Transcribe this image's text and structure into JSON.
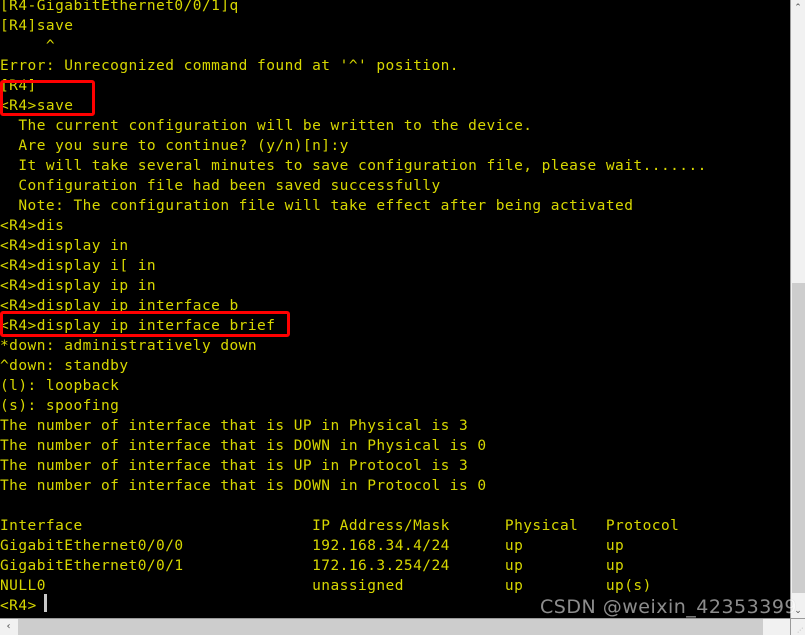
{
  "terminal": {
    "text_color": "#d7d700",
    "background_color": "#000000",
    "highlight_color": "#ff0000",
    "lines": [
      "[R4-GigabitEthernet0/0/1]q",
      "[R4]save",
      "     ^",
      "Error: Unrecognized command found at '^' position.",
      "[R4]",
      "<R4>save",
      "  The current configuration will be written to the device.",
      "  Are you sure to continue? (y/n)[n]:y",
      "  It will take several minutes to save configuration file, please wait.......",
      "  Configuration file had been saved successfully",
      "  Note: The configuration file will take effect after being activated",
      "<R4>dis",
      "<R4>display in",
      "<R4>display i[ in",
      "<R4>display ip in",
      "<R4>display ip interface b",
      "<R4>display ip interface brief",
      "*down: administratively down",
      "^down: standby",
      "(l): loopback",
      "(s): spoofing",
      "The number of interface that is UP in Physical is 3",
      "The number of interface that is DOWN in Physical is 0",
      "The number of interface that is UP in Protocol is 3",
      "The number of interface that is DOWN in Protocol is 0",
      "",
      "Interface                         IP Address/Mask      Physical   Protocol",
      "GigabitEthernet0/0/0              192.168.34.4/24      up         up",
      "GigabitEthernet0/0/1              172.16.3.254/24      up         up",
      "NULL0                             unassigned           up         up(s)",
      "<R4>"
    ],
    "highlights": [
      {
        "label": "save-command-highlight",
        "target_line": "<R4>save"
      },
      {
        "label": "display-ip-interface-brief-highlight",
        "target_line": "<R4>display ip interface brief"
      }
    ],
    "interface_table": {
      "headers": [
        "Interface",
        "IP Address/Mask",
        "Physical",
        "Protocol"
      ],
      "rows": [
        [
          "GigabitEthernet0/0/0",
          "192.168.34.4/24",
          "up",
          "up"
        ],
        [
          "GigabitEthernet0/0/1",
          "172.16.3.254/24",
          "up",
          "up"
        ],
        [
          "NULL0",
          "unassigned",
          "up",
          "up(s)"
        ]
      ]
    },
    "legend": {
      "administratively_down": "*down: administratively down",
      "standby": "^down: standby",
      "loopback": "(l): loopback",
      "spoofing": "(s): spoofing"
    },
    "counters": {
      "up_physical": "3",
      "down_physical": "0",
      "up_protocol": "3",
      "down_protocol": "0"
    },
    "prompt": "<R4>"
  },
  "scrollbars": {
    "vertical_up_arrow": "⌃",
    "vertical_down_arrow": "⌄",
    "horizontal_left_arrow": "‹",
    "horizontal_right_arrow": "›",
    "grip_dots": "⋰"
  },
  "watermark": {
    "text": "CSDN @weixin_42353399"
  }
}
